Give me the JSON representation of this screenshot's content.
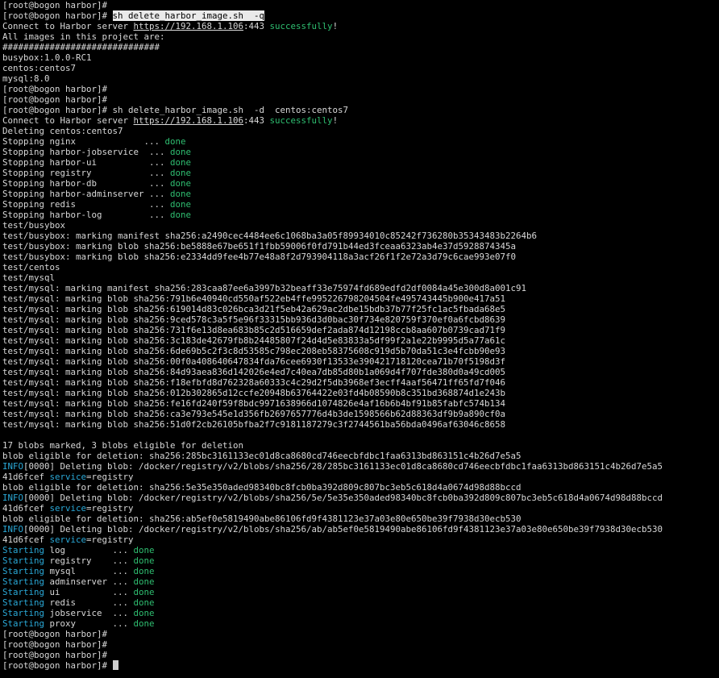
{
  "terminal": {
    "colors": {
      "background": "#000000",
      "text": "#d8d8d8",
      "green": "#2fbf71",
      "cyan": "#2aa9d8",
      "selection": "#eaeaea"
    },
    "lines": [
      [
        {
          "t": "[root@bogon harbor]#"
        }
      ],
      [
        {
          "t": "[root@bogon harbor]# "
        },
        {
          "t": "sh delete_harbor_image.sh  -q",
          "s": "sel"
        }
      ],
      [
        {
          "t": "Connect to Harbor server "
        },
        {
          "t": "https://192.168.1.106",
          "s": "url"
        },
        {
          "t": ":443 "
        },
        {
          "t": "successfully",
          "s": "green"
        },
        {
          "t": "!"
        }
      ],
      [
        {
          "t": "All images in this project are:"
        }
      ],
      [
        {
          "t": "##############################"
        }
      ],
      [
        {
          "t": "busybox:1.0.0-RC1"
        }
      ],
      [
        {
          "t": "centos:centos7"
        }
      ],
      [
        {
          "t": "mysql:8.0"
        }
      ],
      [
        {
          "t": "[root@bogon harbor]#"
        }
      ],
      [
        {
          "t": "[root@bogon harbor]#"
        }
      ],
      [
        {
          "t": "[root@bogon harbor]# sh delete_harbor_image.sh  -d  centos:centos7"
        }
      ],
      [
        {
          "t": "Connect to Harbor server "
        },
        {
          "t": "https://192.168.1.106",
          "s": "url"
        },
        {
          "t": ":443 "
        },
        {
          "t": "successfully",
          "s": "green"
        },
        {
          "t": "!"
        }
      ],
      [
        {
          "t": "Deleting centos:centos7"
        }
      ],
      [
        {
          "t": "Stopping nginx             ... "
        },
        {
          "t": "done",
          "s": "green"
        }
      ],
      [
        {
          "t": "Stopping harbor-jobservice  ... "
        },
        {
          "t": "done",
          "s": "green"
        }
      ],
      [
        {
          "t": "Stopping harbor-ui          ... "
        },
        {
          "t": "done",
          "s": "green"
        }
      ],
      [
        {
          "t": "Stopping registry           ... "
        },
        {
          "t": "done",
          "s": "green"
        }
      ],
      [
        {
          "t": "Stopping harbor-db          ... "
        },
        {
          "t": "done",
          "s": "green"
        }
      ],
      [
        {
          "t": "Stopping harbor-adminserver ... "
        },
        {
          "t": "done",
          "s": "green"
        }
      ],
      [
        {
          "t": "Stopping redis              ... "
        },
        {
          "t": "done",
          "s": "green"
        }
      ],
      [
        {
          "t": "Stopping harbor-log         ... "
        },
        {
          "t": "done",
          "s": "green"
        }
      ],
      [
        {
          "t": "test/busybox"
        }
      ],
      [
        {
          "t": "test/busybox: marking manifest sha256:a2490cec4484ee6c1068ba3a05f89934010c85242f736280b35343483b2264b6"
        }
      ],
      [
        {
          "t": "test/busybox: marking blob sha256:be5888e67be651f1fbb59006f0fd791b44ed3fceaa6323ab4e37d5928874345a"
        }
      ],
      [
        {
          "t": "test/busybox: marking blob sha256:e2334dd9fee4b77e48a8f2d793904118a3acf26f1f2e72a3d79c6cae993e07f0"
        }
      ],
      [
        {
          "t": "test/centos"
        }
      ],
      [
        {
          "t": "test/mysql"
        }
      ],
      [
        {
          "t": "test/mysql: marking manifest sha256:283caa87ee6a3997b32beaff33e75974fd689edfd2df0084a45e300d8a001c91"
        }
      ],
      [
        {
          "t": "test/mysql: marking blob sha256:791b6e40940cd550af522eb4ffe995226798204504fe495743445b900e417a51"
        }
      ],
      [
        {
          "t": "test/mysql: marking blob sha256:619014d83c026bca3d21f5eb42a629ac2dbe15bdb37b77f25fc1ac5fbada68e5"
        }
      ],
      [
        {
          "t": "test/mysql: marking blob sha256:9ced578c3a5f5e96f33315bb936d3d0bac30f734e820759f370ef0a6fcbd8639"
        }
      ],
      [
        {
          "t": "test/mysql: marking blob sha256:731f6e13d8ea683b85c2d516659def2ada874d12198ccb8aa607b0739cad71f9"
        }
      ],
      [
        {
          "t": "test/mysql: marking blob sha256:3c183de42679fb8b24485807f24d4d5e83833a5df99f2a1e22b9995d5a77a61c"
        }
      ],
      [
        {
          "t": "test/mysql: marking blob sha256:6de69b5c2f3c8d53585c798ec208eb58375608c919d5b70da51c3e4fcbb90e93"
        }
      ],
      [
        {
          "t": "test/mysql: marking blob sha256:00f0a408640647834fda76cee6930f13533e390421718120cea71b70f5198d3f"
        }
      ],
      [
        {
          "t": "test/mysql: marking blob sha256:84d93aea836d142026e4ed7c40ea7db85d80b1a069d4f707fde380d0a49cd005"
        }
      ],
      [
        {
          "t": "test/mysql: marking blob sha256:f18efbfd8d762328a60333c4c29d2f5db3968ef3ecff4aaf56471ff65fd7f046"
        }
      ],
      [
        {
          "t": "test/mysql: marking blob sha256:012b302865d12ccfe20948b63764422e03fd4b08590b8c351bd368874d1e243b"
        }
      ],
      [
        {
          "t": "test/mysql: marking blob sha256:fe16fd240f59f8bdc9971638966d1074826e4af16b6b4bf91b85fabfc574b134"
        }
      ],
      [
        {
          "t": "test/mysql: marking blob sha256:ca3e793e545e1d356fb2697657776d4b3de1598566b62d88363df9b9a890cf0a"
        }
      ],
      [
        {
          "t": "test/mysql: marking blob sha256:51d0f2cb26105bfba2f7c9181187279c3f2744561ba56bda0496af63046c8658"
        }
      ],
      [
        {
          "t": ""
        }
      ],
      [
        {
          "t": "17 blobs marked, 3 blobs eligible for deletion"
        }
      ],
      [
        {
          "t": "blob eligible for deletion: sha256:285bc3161133ec01d8ca8680cd746eecbfdbc1faa6313bd863151c4b26d7e5a5"
        }
      ],
      [
        {
          "t": "INFO",
          "s": "cyan"
        },
        {
          "t": "[0000] Deleting blob: /docker/registry/v2/blobs/sha256/28/285bc3161133ec01d8ca8680cd746eecbfdbc1faa6313bd863151c4b26d7e5a5"
        }
      ],
      [
        {
          "t": "41d6fcef "
        },
        {
          "t": "service",
          "s": "cyan"
        },
        {
          "t": "=registry"
        }
      ],
      [
        {
          "t": "blob eligible for deletion: sha256:5e35e350aded98340bc8fcb0ba392d809c807bc3eb5c618d4a0674d98d88bccd"
        }
      ],
      [
        {
          "t": "INFO",
          "s": "cyan"
        },
        {
          "t": "[0000] Deleting blob: /docker/registry/v2/blobs/sha256/5e/5e35e350aded98340bc8fcb0ba392d809c807bc3eb5c618d4a0674d98d88bccd"
        }
      ],
      [
        {
          "t": "41d6fcef "
        },
        {
          "t": "service",
          "s": "cyan"
        },
        {
          "t": "=registry"
        }
      ],
      [
        {
          "t": "blob eligible for deletion: sha256:ab5ef0e5819490abe86106fd9f4381123e37a03e80e650be39f7938d30ecb530"
        }
      ],
      [
        {
          "t": "INFO",
          "s": "cyan"
        },
        {
          "t": "[0000] Deleting blob: /docker/registry/v2/blobs/sha256/ab/ab5ef0e5819490abe86106fd9f4381123e37a03e80e650be39f7938d30ecb530"
        }
      ],
      [
        {
          "t": "41d6fcef "
        },
        {
          "t": "service",
          "s": "cyan"
        },
        {
          "t": "=registry"
        }
      ],
      [
        {
          "t": "Starting",
          "s": "cyan"
        },
        {
          "t": " log         ... "
        },
        {
          "t": "done",
          "s": "green"
        }
      ],
      [
        {
          "t": "Starting",
          "s": "cyan"
        },
        {
          "t": " registry    ... "
        },
        {
          "t": "done",
          "s": "green"
        }
      ],
      [
        {
          "t": "Starting",
          "s": "cyan"
        },
        {
          "t": " mysql       ... "
        },
        {
          "t": "done",
          "s": "green"
        }
      ],
      [
        {
          "t": "Starting",
          "s": "cyan"
        },
        {
          "t": " adminserver ... "
        },
        {
          "t": "done",
          "s": "green"
        }
      ],
      [
        {
          "t": "Starting",
          "s": "cyan"
        },
        {
          "t": " ui          ... "
        },
        {
          "t": "done",
          "s": "green"
        }
      ],
      [
        {
          "t": "Starting",
          "s": "cyan"
        },
        {
          "t": " redis       ... "
        },
        {
          "t": "done",
          "s": "green"
        }
      ],
      [
        {
          "t": "Starting",
          "s": "cyan"
        },
        {
          "t": " jobservice  ... "
        },
        {
          "t": "done",
          "s": "green"
        }
      ],
      [
        {
          "t": "Starting",
          "s": "cyan"
        },
        {
          "t": " proxy       ... "
        },
        {
          "t": "done",
          "s": "green"
        }
      ],
      [
        {
          "t": "[root@bogon harbor]#"
        }
      ],
      [
        {
          "t": "[root@bogon harbor]#"
        }
      ],
      [
        {
          "t": "[root@bogon harbor]#"
        }
      ],
      [
        {
          "t": "[root@bogon harbor]# "
        },
        {
          "t": "",
          "s": "cursor"
        }
      ]
    ]
  }
}
